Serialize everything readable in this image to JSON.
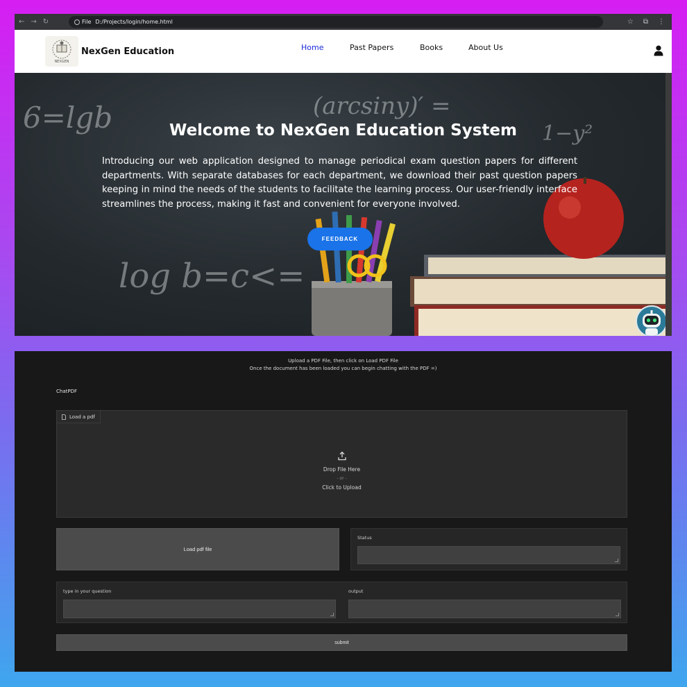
{
  "browser": {
    "scheme": "File",
    "url": "D:/Projects/login/home.html"
  },
  "site": {
    "brand": "NexGen Education",
    "logo_text": "NEXGEN",
    "nav": [
      "Home",
      "Past Papers",
      "Books",
      "About Us"
    ],
    "active_nav": "Home",
    "accent": "#1a73e8"
  },
  "hero": {
    "title": "Welcome to NexGen Education System",
    "paragraph": "Introducing our web application designed to manage periodical exam question papers for different departments. With separate databases for each department, we download their past question papers keeping in mind the needs of the students to facilitate the learning process. Our user-friendly interface streamlines the process, making it fast and convenient for everyone involved.",
    "button": "FEEDBACK"
  },
  "chat_app": {
    "intro_line1_pre": "Upload a PDF File, then click on Load PDF File",
    "intro_line2": "Once the document has been loaded you can begin chatting with the PDF =)",
    "title": "ChatPDF",
    "upload_tag": "Load a pdf",
    "drop_text": "Drop File Here",
    "or_text": "- or -",
    "click_text": "Click to Upload",
    "load_button": "Load pdf file",
    "status_label": "Status",
    "question_label": "type in your question",
    "output_label": "output",
    "submit_button": "submit"
  }
}
